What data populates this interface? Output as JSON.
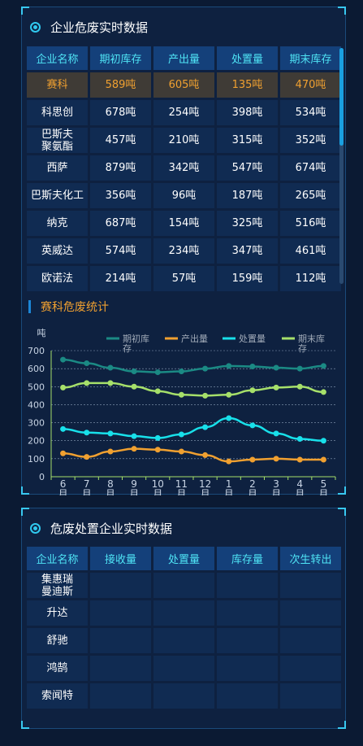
{
  "panel1": {
    "title": "企业危废实时数据",
    "headers": [
      "企业名称",
      "期初库存",
      "产出量",
      "处置量",
      "期末库存"
    ],
    "rows": [
      [
        "赛科",
        "589吨",
        "605吨",
        "135吨",
        "470吨"
      ],
      [
        "科思创",
        "678吨",
        "254吨",
        "398吨",
        "534吨"
      ],
      [
        "巴斯夫\n聚氨酯",
        "457吨",
        "210吨",
        "315吨",
        "352吨"
      ],
      [
        "西萨",
        "879吨",
        "342吨",
        "547吨",
        "674吨"
      ],
      [
        "巴斯夫化工",
        "356吨",
        "96吨",
        "187吨",
        "265吨"
      ],
      [
        "纳克",
        "687吨",
        "154吨",
        "325吨",
        "516吨"
      ],
      [
        "英威达",
        "574吨",
        "234吨",
        "347吨",
        "461吨"
      ],
      [
        "欧诺法",
        "214吨",
        "57吨",
        "159吨",
        "112吨"
      ]
    ]
  },
  "chart_title": "赛科危废统计",
  "chart_data": {
    "type": "line",
    "ylabel": "吨",
    "categories": [
      "6\n月",
      "7\n月",
      "8\n月",
      "9\n月",
      "10\n月",
      "11\n月",
      "12\n月",
      "1\n月",
      "2\n月",
      "3\n月",
      "4\n月",
      "5\n月"
    ],
    "ylim": [
      0,
      700
    ],
    "yticks": [
      0,
      100,
      200,
      300,
      400,
      500,
      600,
      700
    ],
    "legend_position": "top",
    "series": [
      {
        "name": "期初库\n存",
        "color": "#1b8a84",
        "values": [
          650,
          630,
          605,
          585,
          580,
          585,
          600,
          615,
          612,
          605,
          600,
          615
        ]
      },
      {
        "name": "产出量",
        "color": "#f0a030",
        "values": [
          130,
          110,
          140,
          155,
          150,
          140,
          120,
          85,
          95,
          100,
          95,
          95
        ]
      },
      {
        "name": "处置量",
        "color": "#18e0ea",
        "values": [
          265,
          245,
          240,
          225,
          215,
          235,
          275,
          325,
          285,
          240,
          210,
          200
        ]
      },
      {
        "name": "期末库\n存",
        "color": "#a6e06a",
        "values": [
          495,
          520,
          520,
          500,
          475,
          455,
          450,
          455,
          480,
          495,
          500,
          470
        ]
      }
    ]
  },
  "panel2": {
    "title": "危废处置企业实时数据",
    "headers": [
      "企业名称",
      "接收量",
      "处置量",
      "库存量",
      "次生转出"
    ],
    "rows": [
      [
        "集惠瑞\n曼迪斯",
        "",
        "",
        "",
        ""
      ],
      [
        "升达",
        "",
        "",
        "",
        ""
      ],
      [
        "舒驰",
        "",
        "",
        "",
        ""
      ],
      [
        "鸿鹄",
        "",
        "",
        "",
        ""
      ],
      [
        "索闻特",
        "",
        "",
        "",
        ""
      ]
    ]
  }
}
